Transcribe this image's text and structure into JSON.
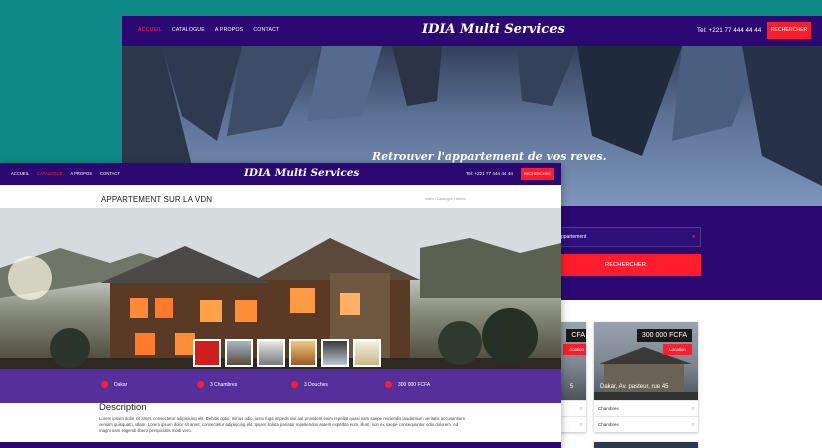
{
  "back_window": {
    "nav": {
      "items": [
        "ACCUEIL",
        "CATALOGUE",
        "A PROPOS",
        "CONTACT"
      ],
      "active": "ACCUEIL",
      "brand": "IDIA Multi Services",
      "phone": "Tel: +221 77 444 44 44",
      "search_button": "RECHERCHER"
    },
    "hero_tagline": "Retrouver l'appartement de vos reves.",
    "search": {
      "select_value": "ppartement",
      "button": "RECHERCHER"
    },
    "cards": [
      {
        "price": "CFA",
        "type": "ocation",
        "address": "5",
        "rows": [
          {
            "label": "",
            "value": "0"
          },
          {
            "label": "",
            "value": "0"
          }
        ]
      },
      {
        "price": "300 000 FCFA",
        "type": "Location",
        "address": "Dakar, Av. pasteur, rue 45",
        "rows": [
          {
            "label": "Chambres",
            "value": "0"
          },
          {
            "label": "Chambres",
            "value": "0"
          }
        ]
      }
    ]
  },
  "front_window": {
    "nav": {
      "items": [
        "ACCUEIL",
        "CATALOGUE",
        "A PROPOS",
        "CONTACT"
      ],
      "active": "CATALOGUE",
      "brand": "IDIA Multi Services",
      "phone": "Tel: +221 77 444 44 44",
      "search_button": "RECHERCHER"
    },
    "page_title": "APPARTEMENT SUR LA VDN",
    "breadcrumb": "Index / Catalogue / Article",
    "features": [
      "Dakar",
      "3 Chambres",
      "3 Douches",
      "300 000 FCFA"
    ],
    "description_heading": "Description",
    "description_text": "Lorem ipsum dolor sit amet, consectetur adipisicing elit. Debitis optio, minus odio, iusto fuga impedit nisi aut provident enim repellat quasi nam saepe reiciendis laudantium veritatis accusantium veniam quisquam, ullam. Lorem ipsum dolor sit amet, consectetur adipisicing elit. Ipsam soluta pariatur repellendus autem expedita eum, illum, non ex saepe consequuntur odio dolorem. Ad magni nam eligendi libero perspiciatis modi vero."
  },
  "colors": {
    "nav": "#2b0872",
    "accent": "#ff1c2c",
    "feature_bar": "#55309b",
    "background": "#0f8a86"
  }
}
